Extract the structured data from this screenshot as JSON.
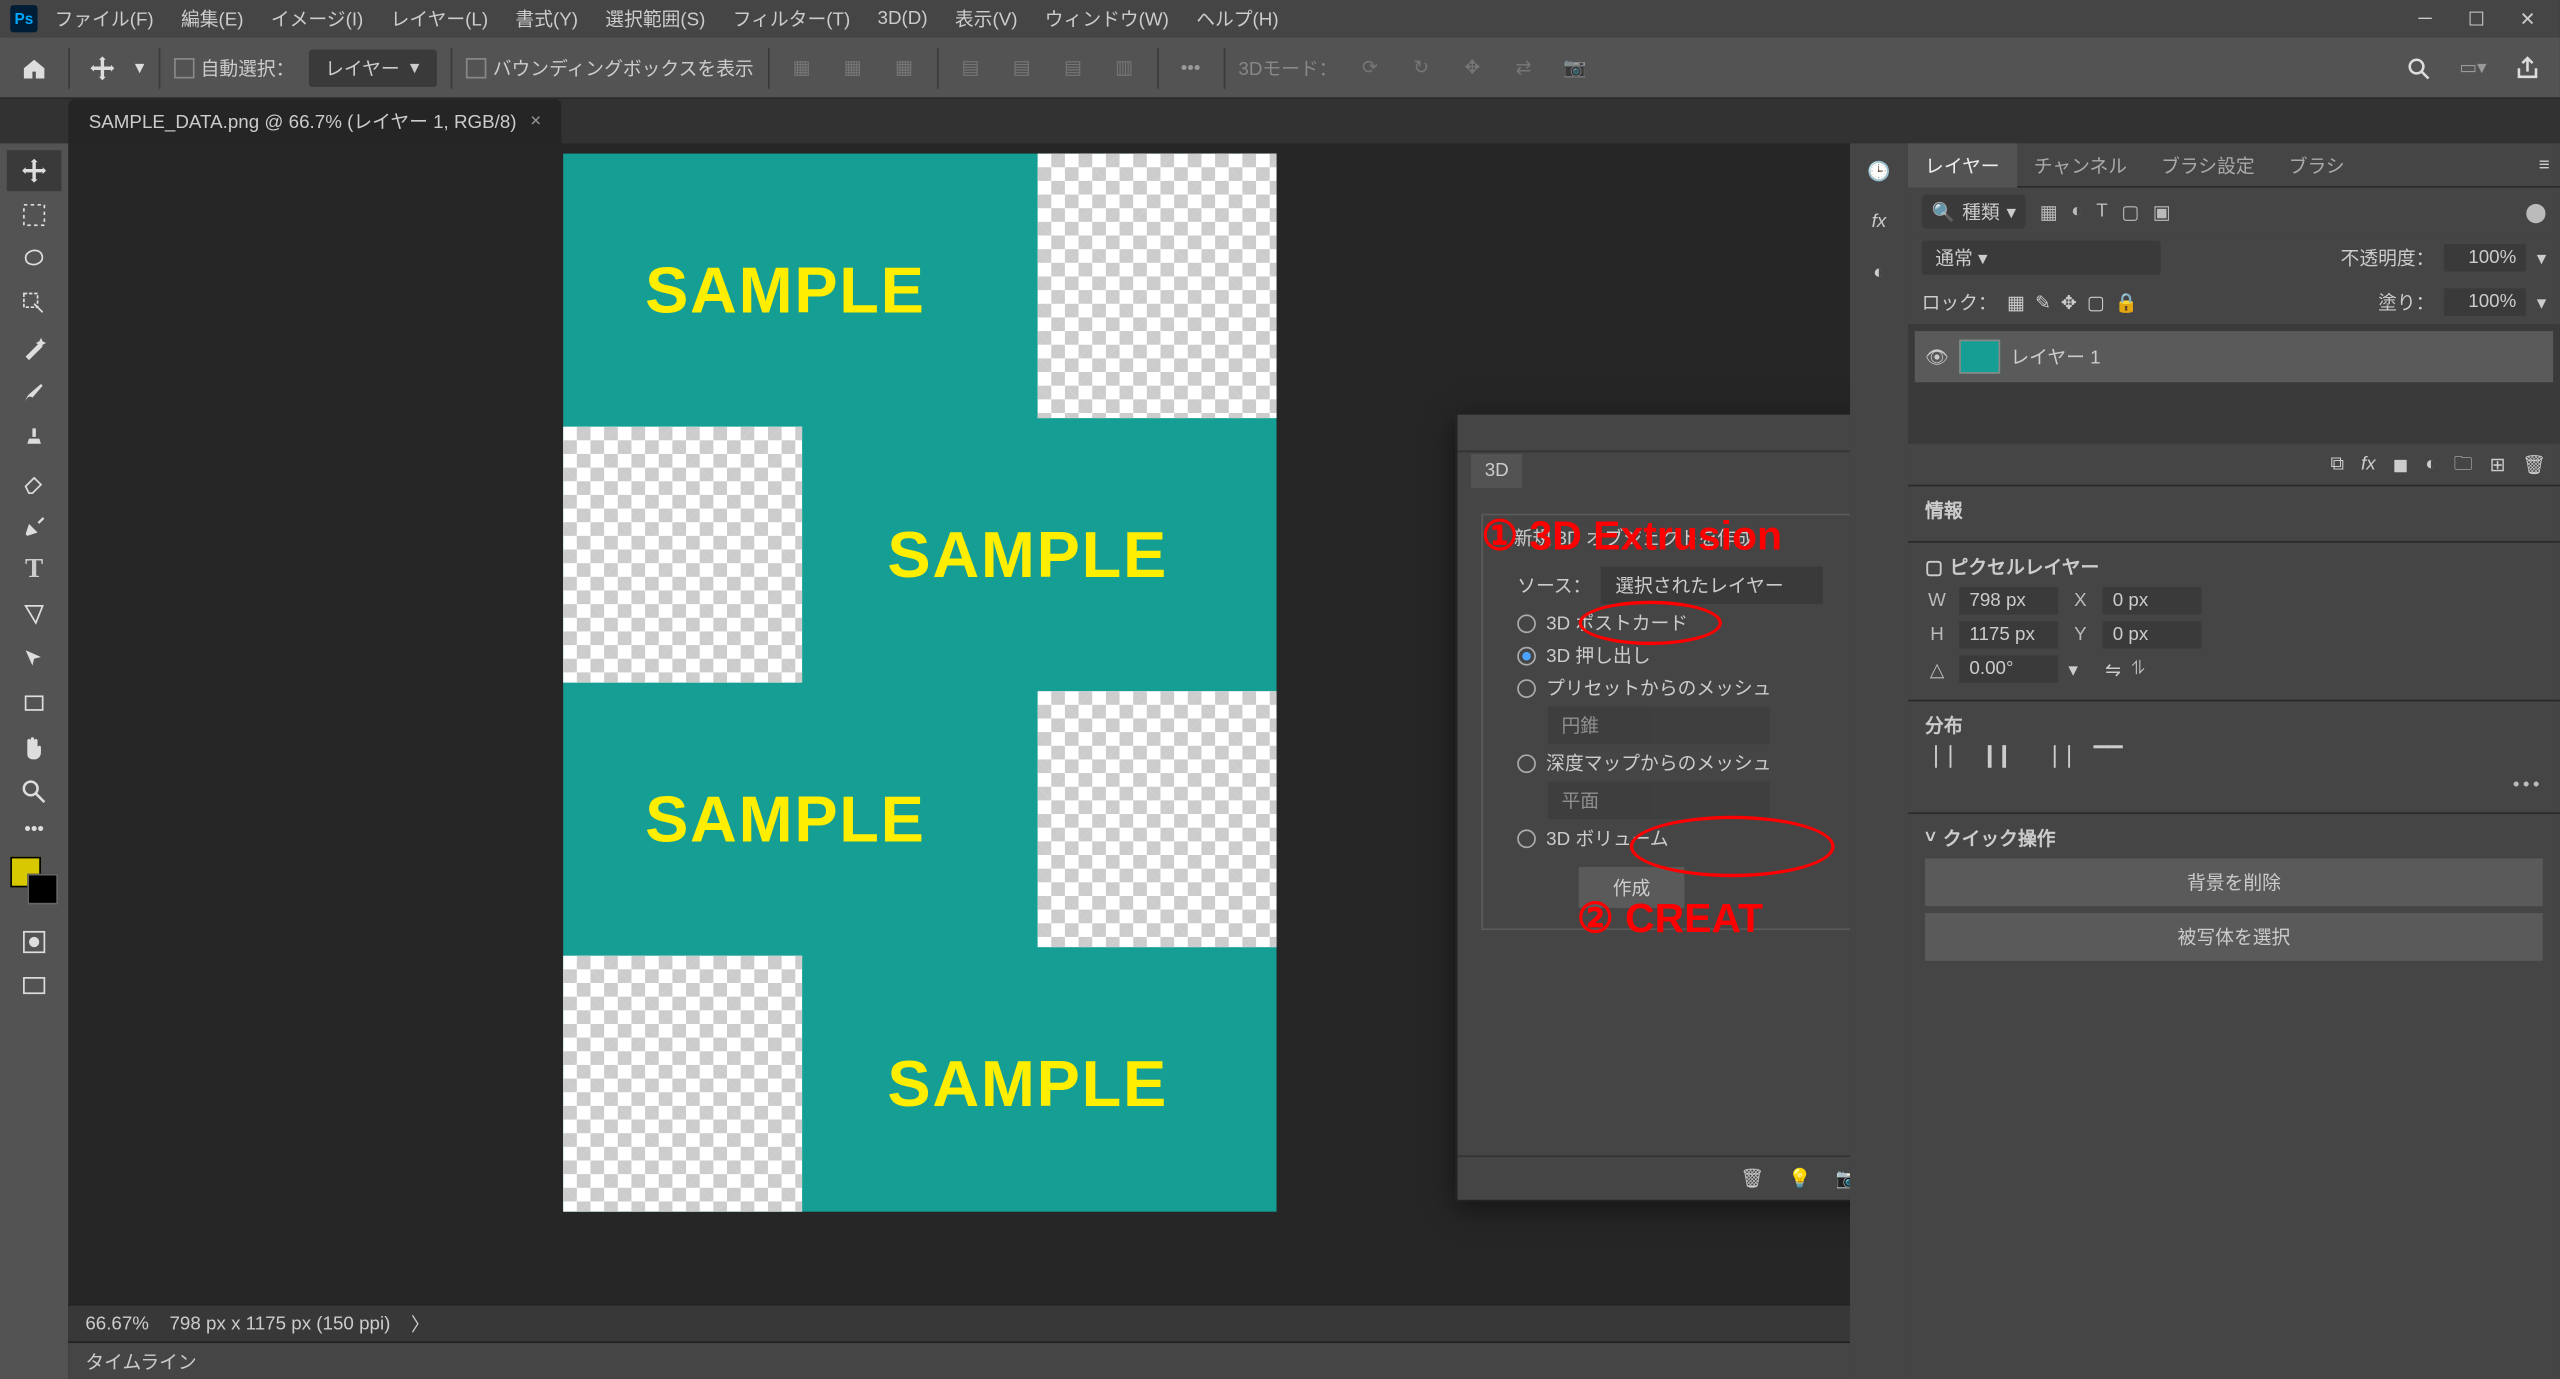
{
  "menu": {
    "items": [
      "ファイル(F)",
      "編集(E)",
      "イメージ(I)",
      "レイヤー(L)",
      "書式(Y)",
      "選択範囲(S)",
      "フィルター(T)",
      "3D(D)",
      "表示(V)",
      "ウィンドウ(W)",
      "ヘルプ(H)"
    ]
  },
  "options": {
    "auto_select_label": "自動選択：",
    "layer_dropdown": "レイヤー",
    "show_bbox": "バウンディングボックスを表示",
    "mode3d_label": "3Dモード："
  },
  "tab_title": "SAMPLE_DATA.png @ 66.7% (レイヤー 1, RGB/8)",
  "canvas": {
    "sample": "SAMPLE"
  },
  "status": {
    "zoom": "66.67%",
    "dims": "798 px x 1175 px (150 ppi)"
  },
  "timeline": "タイムライン",
  "layers_panel": {
    "tabs": [
      "レイヤー",
      "チャンネル",
      "ブラシ設定",
      "ブラシ"
    ],
    "filter_label": "種類",
    "blend": "通常",
    "opacity_label": "不透明度：",
    "opacity_val": "100%",
    "lock_label": "ロック：",
    "fill_label": "塗り：",
    "fill_val": "100%",
    "layer_name": "レイヤー 1"
  },
  "props": {
    "info_tab": "情報",
    "pixel_layer": "ピクセルレイヤー",
    "w": "798 px",
    "x_lbl": "X",
    "x": "0 px",
    "h": "1175 px",
    "y_lbl": "Y",
    "y": "0 px",
    "angle": "0.00°",
    "distribute": "分布",
    "quick_hdr": "クイック操作",
    "remove_bg": "背景を削除",
    "select_subject": "被写体を選択"
  },
  "panel3d": {
    "tab": "3D",
    "group_title": "新規 3D オブジェクトを作成",
    "source_label": "ソース：",
    "source_value": "選択されたレイヤー",
    "opt_postcard": "3D ポストカード",
    "opt_extrude": "3D 押し出し",
    "opt_preset": "プリセットからのメッシュ",
    "preset_value": "円錐",
    "opt_depth": "深度マップからのメッシュ",
    "depth_value": "平面",
    "opt_volume": "3D ボリューム",
    "create": "作成"
  },
  "annotations": {
    "a1": "① 3D Extrusion",
    "a2": "② CREAT"
  }
}
